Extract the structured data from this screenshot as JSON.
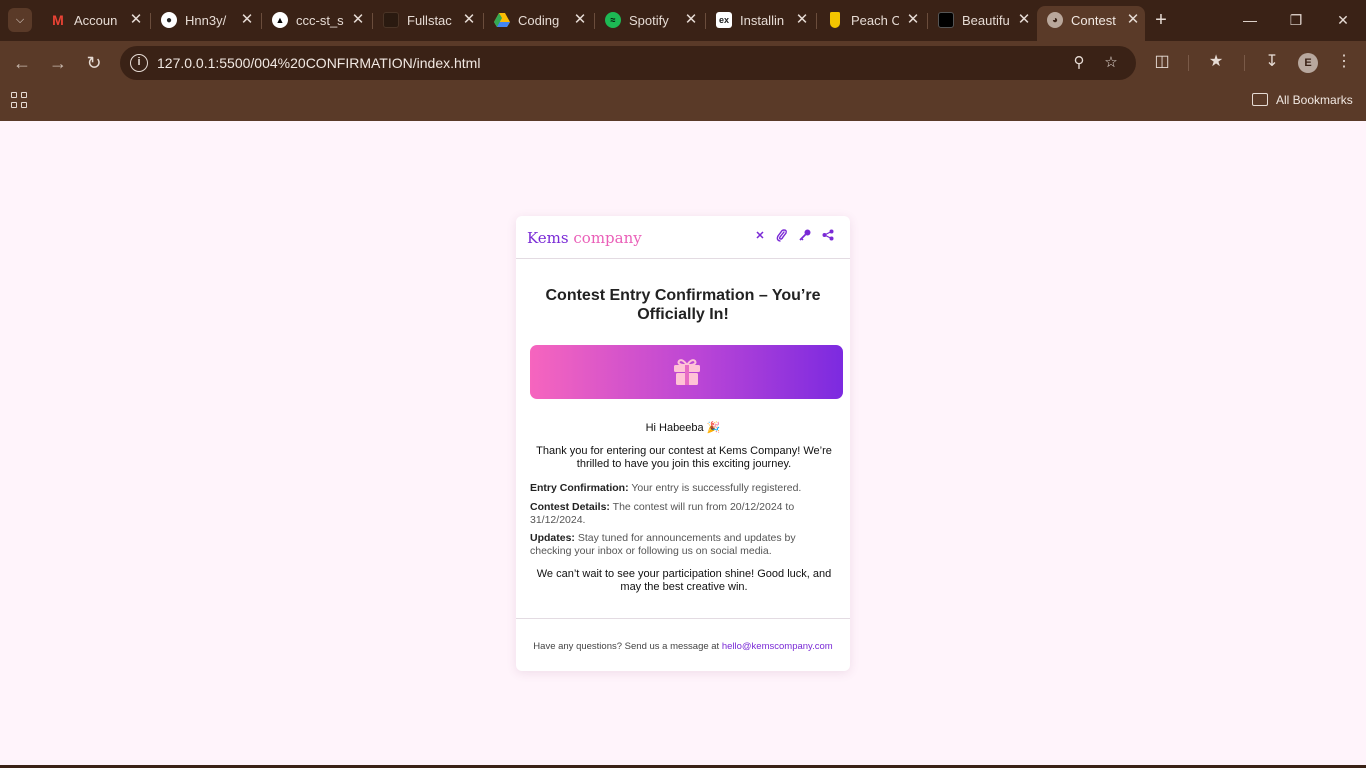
{
  "browser": {
    "tabs": [
      {
        "title": "Accoun",
        "icon": "gmail-icon",
        "color": "#ea4335"
      },
      {
        "title": "Hnn3y/",
        "icon": "github-icon",
        "color": "#ffffff"
      },
      {
        "title": "ccc-st_s",
        "icon": "triangle-icon",
        "color": "#000000"
      },
      {
        "title": "Fullstac",
        "icon": "square-icon",
        "color": "#2a1a10"
      },
      {
        "title": "Coding",
        "icon": "drive-icon",
        "color": "#34a853"
      },
      {
        "title": "Spotify",
        "icon": "spotify-icon",
        "color": "#1db954"
      },
      {
        "title": "Installin",
        "icon": "ex-icon",
        "color": "#ffffff"
      },
      {
        "title": "Peach C",
        "icon": "peach-icon",
        "color": "#f2c400"
      },
      {
        "title": "Beautifu",
        "icon": "beautiful-icon",
        "color": "#000000"
      },
      {
        "title": "Contest",
        "icon": "globe-icon",
        "color": "#b9a79b",
        "active": true
      }
    ],
    "url": "127.0.0.1:5500/004%20CONFIRMATION/index.html",
    "profile_initial": "E",
    "bookmarks_label": "All Bookmarks"
  },
  "email": {
    "brand_part1": "Kems",
    "brand_part2": "company",
    "header_icons": [
      "close-icon",
      "paperclip-icon",
      "key-icon",
      "share-icon"
    ],
    "headline": "Contest Entry Confirmation – You’re Officially In!",
    "banner_icon": "gift-icon",
    "greeting": "Hi Habeeba 🎉",
    "intro": "Thank you for entering our contest at Kems Company! We’re thrilled to have you join this exciting journey.",
    "details": [
      {
        "label": "Entry Confirmation:",
        "text": "Your entry is successfully registered."
      },
      {
        "label": "Contest Details:",
        "text": "The contest will run from 20/12/2024 to 31/12/2024."
      },
      {
        "label": "Updates:",
        "text": "Stay tuned for announcements and updates by checking your inbox or following us on social media."
      }
    ],
    "closing": "We can’t wait to see your participation shine! Good luck, and may the best creative win.",
    "footer_text": "Have any questions? Send us a message at",
    "footer_email": "hello@kemscompany.com",
    "colors": {
      "accent_purple": "#7a2ad6",
      "accent_pink": "#ea5fb8",
      "gradient_start": "#f665be",
      "gradient_end": "#7c2ae0",
      "page_background": "#fff4fb"
    }
  }
}
